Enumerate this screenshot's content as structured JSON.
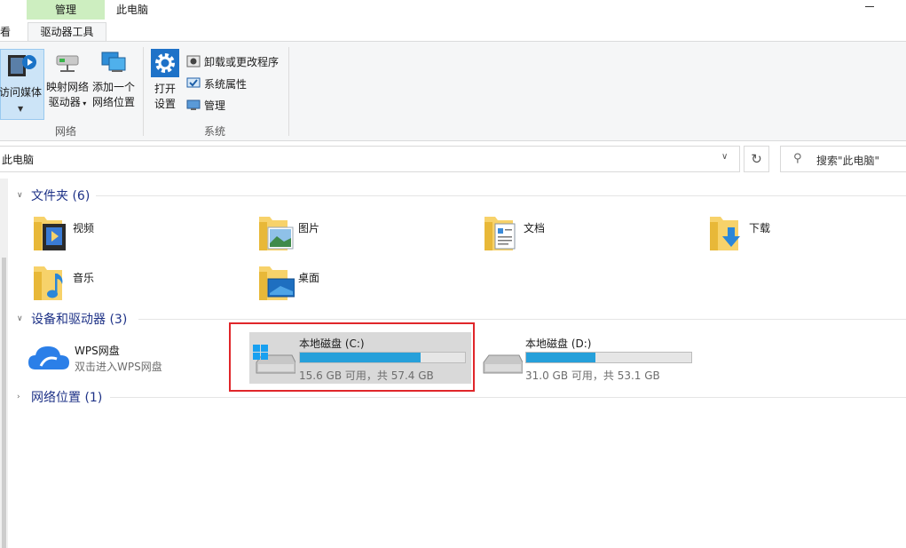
{
  "window": {
    "title": "此电脑",
    "context_tab_group": "管理",
    "tabs": [
      {
        "label": "看"
      },
      {
        "label": "驱动器工具"
      }
    ]
  },
  "ribbon": {
    "media_button": "访问媒体",
    "map_drive": {
      "line1": "映射网络",
      "line2": "驱动器"
    },
    "add_location": {
      "line1": "添加一个",
      "line2": "网络位置"
    },
    "network_group_label": "网络",
    "open_settings": {
      "line1": "打开",
      "line2": "设置"
    },
    "uninstall": "卸载或更改程序",
    "system_properties": "系统属性",
    "manage": "管理",
    "system_group_label": "系统"
  },
  "address": {
    "path": "此电脑",
    "search_placeholder": "搜索\"此电脑\""
  },
  "sections": {
    "folders": {
      "header": "文件夹 (6)",
      "items": [
        {
          "label": "视频",
          "icon": "video-folder-icon"
        },
        {
          "label": "图片",
          "icon": "pictures-folder-icon"
        },
        {
          "label": "文档",
          "icon": "documents-folder-icon"
        },
        {
          "label": "下载",
          "icon": "downloads-folder-icon"
        },
        {
          "label": "音乐",
          "icon": "music-folder-icon"
        },
        {
          "label": "桌面",
          "icon": "desktop-folder-icon"
        }
      ]
    },
    "devices": {
      "header": "设备和驱动器 (3)",
      "wps": {
        "name": "WPS网盘",
        "subtitle": "双击进入WPS网盘"
      },
      "drives": [
        {
          "name": "本地磁盘 (C:)",
          "space": "15.6 GB 可用，共 57.4 GB",
          "used_fraction": 0.73,
          "selected": true
        },
        {
          "name": "本地磁盘 (D:)",
          "space": "31.0 GB 可用，共 53.1 GB",
          "used_fraction": 0.42,
          "selected": false
        }
      ]
    },
    "network": {
      "header": "网络位置 (1)"
    }
  },
  "colors": {
    "drive_bar_fill": "#26a0da",
    "highlight_outline": "#e0262a",
    "context_tab": "#cdeec0",
    "section_header": "#1e3287"
  }
}
